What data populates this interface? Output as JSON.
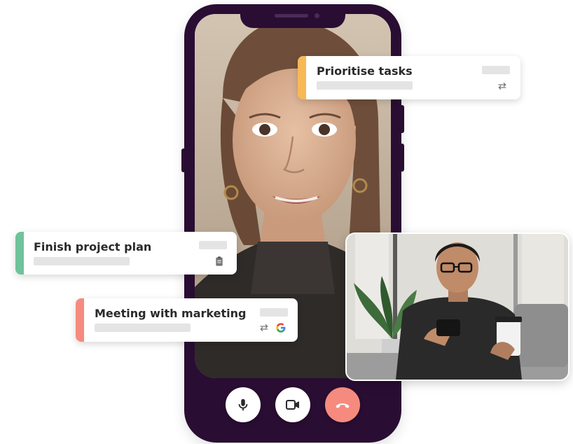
{
  "task_cards": [
    {
      "title": "Prioritise tasks",
      "accent_color": "#f7b955",
      "icons": [
        "repeat-icon"
      ]
    },
    {
      "title": "Finish project plan",
      "accent_color": "#6fc29a",
      "icons": [
        "clipboard-icon"
      ]
    },
    {
      "title": "Meeting with marketing",
      "accent_color": "#f58b7e",
      "icons": [
        "repeat-icon",
        "google-icon"
      ]
    }
  ],
  "call_controls": [
    {
      "icon": "microphone-icon"
    },
    {
      "icon": "video-camera-icon"
    },
    {
      "icon": "end-call-icon",
      "color": "#f58b7e"
    }
  ],
  "colors": {
    "phone_frame": "#2a0d33",
    "end_call": "#f58b7e"
  }
}
